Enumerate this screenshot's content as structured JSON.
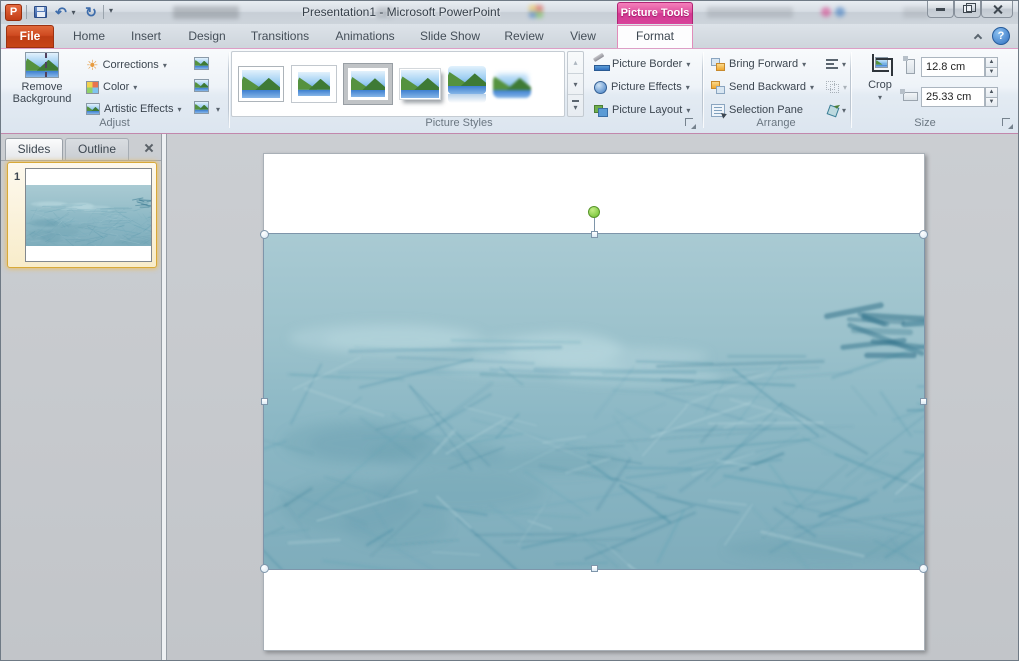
{
  "titlebar": {
    "title": "Presentation1  -  Microsoft PowerPoint",
    "contextual": "Picture Tools"
  },
  "tabs": {
    "file": "File",
    "home": "Home",
    "insert": "Insert",
    "design": "Design",
    "transitions": "Transitions",
    "animations": "Animations",
    "slide_show": "Slide Show",
    "review": "Review",
    "view": "View",
    "format": "Format"
  },
  "adjust": {
    "remove_background": "Remove Background",
    "corrections": "Corrections",
    "color": "Color",
    "artistic_effects": "Artistic Effects",
    "label": "Adjust"
  },
  "styles_group": {
    "label": "Picture Styles",
    "border": "Picture Border",
    "effects": "Picture Effects",
    "layout": "Picture Layout"
  },
  "arrange": {
    "bring_forward": "Bring Forward",
    "send_backward": "Send Backward",
    "selection_pane": "Selection Pane",
    "label": "Arrange"
  },
  "size": {
    "crop": "Crop",
    "height": "12.8 cm",
    "width": "25.33 cm",
    "label": "Size"
  },
  "sidebar": {
    "slides": "Slides",
    "outline": "Outline",
    "slide_number": "1"
  },
  "colors": {
    "contextual_pink": "#d23892",
    "file_orange": "#c74518",
    "picture_teal_light": "#a9cad3",
    "picture_teal_dark": "#3c8098",
    "rotation_handle_green": "#6cbf2e"
  }
}
